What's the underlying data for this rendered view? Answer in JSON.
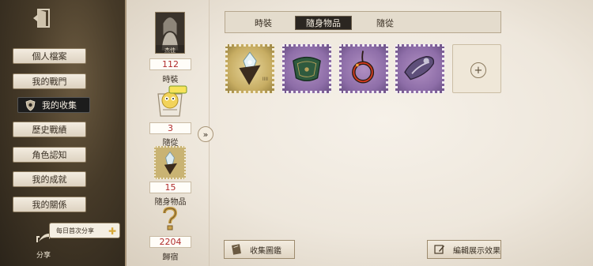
{
  "nav": {
    "items": [
      {
        "label": "個人檔案"
      },
      {
        "label": "我的戰門"
      },
      {
        "label": "我的收集"
      },
      {
        "label": "歷史戰績"
      },
      {
        "label": "角色認知"
      },
      {
        "label": "我的成就"
      },
      {
        "label": "我的關係"
      }
    ]
  },
  "share": {
    "bubble_label": "每日首次分享",
    "label": "分享"
  },
  "stats": {
    "portrait_caption": "杰佳",
    "costume": {
      "value": "112",
      "label": "時裝"
    },
    "follower": {
      "value": "3",
      "label": "隨從"
    },
    "accessory": {
      "value": "15",
      "label": "隨身物品"
    },
    "homeland": {
      "value": "2204",
      "label": "歸宿"
    }
  },
  "tabs": [
    {
      "label": "時裝"
    },
    {
      "label": "隨身物品"
    },
    {
      "label": "隨從"
    }
  ],
  "items": [
    {
      "icon": "crystal-pendulum-icon",
      "caption": "IIII"
    },
    {
      "icon": "green-pillow-icon"
    },
    {
      "icon": "red-ring-pendant-icon"
    },
    {
      "icon": "purple-ornament-icon"
    }
  ],
  "buttons": {
    "collection_guide": "收集圖鑑",
    "edit_display": "編輯展示效果",
    "add": "+"
  },
  "colors": {
    "accent_red": "#b02c2c",
    "tab_active_bg": "#2b2621",
    "stamp_purple": "#8e6ea8",
    "stamp_gold": "#c7ad63"
  }
}
